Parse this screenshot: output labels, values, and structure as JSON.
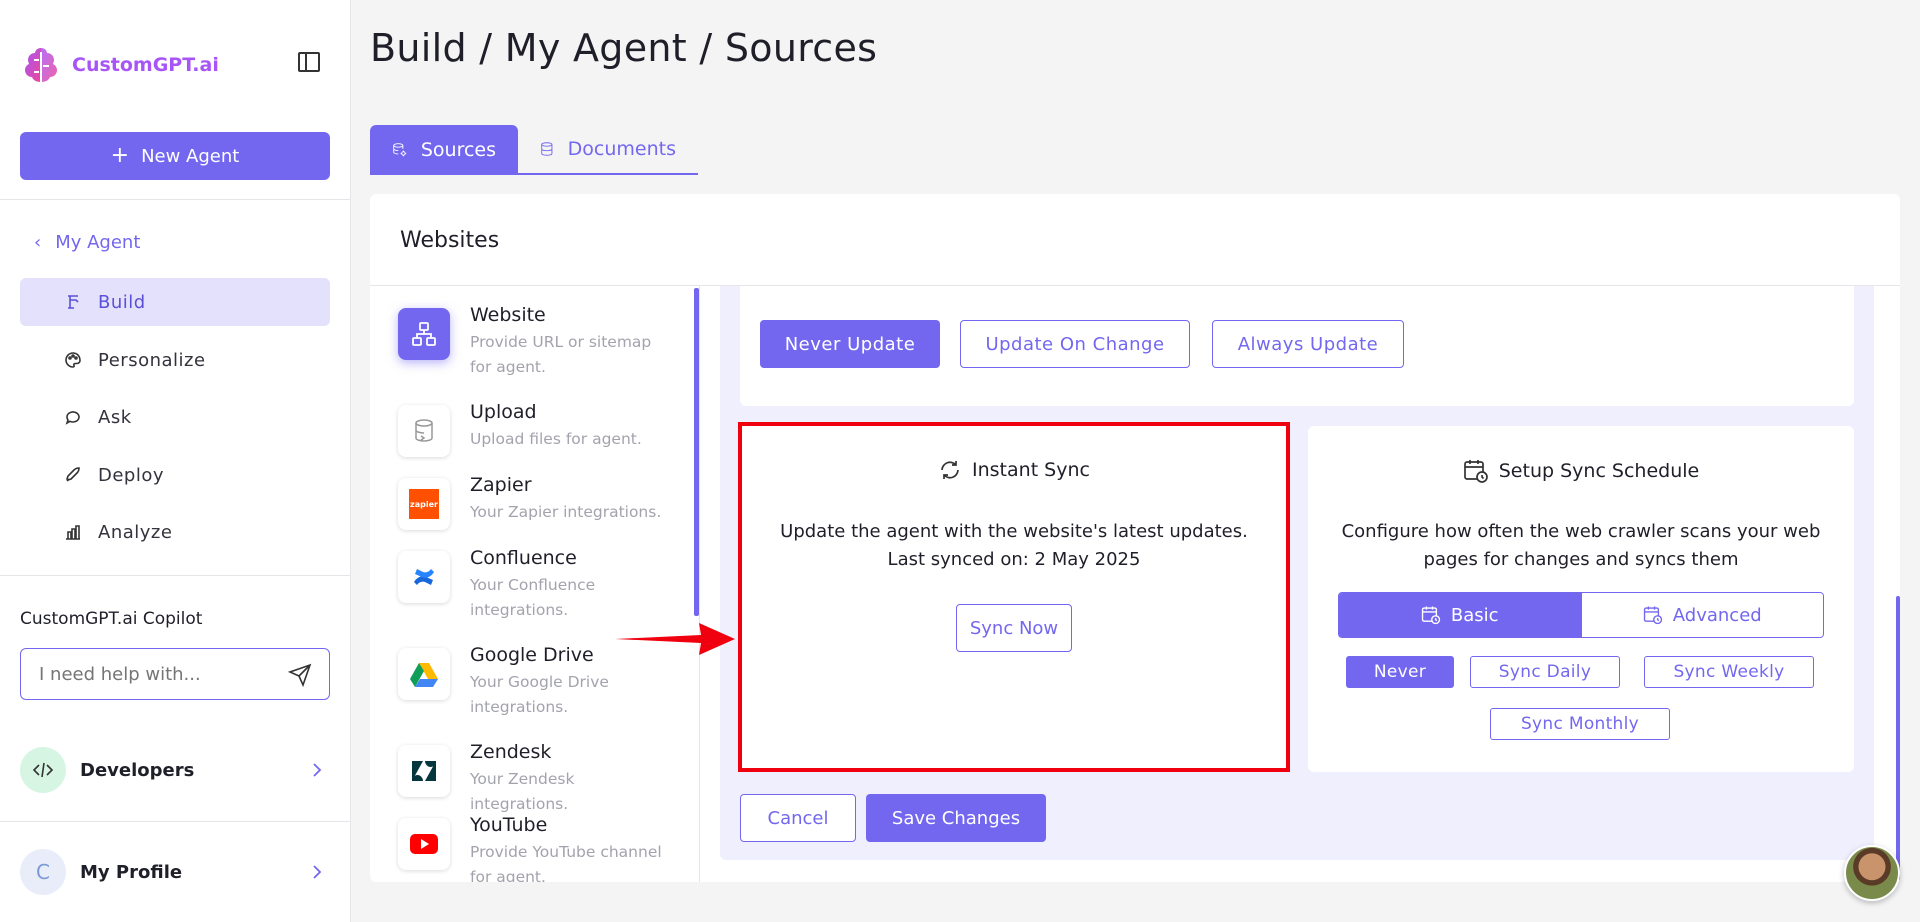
{
  "brand": {
    "name": "CustomGPT.ai"
  },
  "sidebar": {
    "new_agent_label": "New Agent",
    "back_label": "My Agent",
    "nav": [
      {
        "label": "Build",
        "icon": "build-icon",
        "active": true
      },
      {
        "label": "Personalize",
        "icon": "palette-icon",
        "active": false
      },
      {
        "label": "Ask",
        "icon": "chat-icon",
        "active": false
      },
      {
        "label": "Deploy",
        "icon": "rocket-icon",
        "active": false
      },
      {
        "label": "Analyze",
        "icon": "bar-chart-icon",
        "active": false
      }
    ],
    "copilot": {
      "title": "CustomGPT.ai Copilot",
      "placeholder": "I need help with..."
    },
    "developers_label": "Developers",
    "profile": {
      "initial": "C",
      "label": "My Profile"
    }
  },
  "header": {
    "breadcrumb": "Build / My Agent / Sources"
  },
  "tabs": [
    {
      "label": "Sources",
      "active": true
    },
    {
      "label": "Documents",
      "active": false
    }
  ],
  "panel": {
    "title": "Websites",
    "sources": [
      {
        "name": "Website",
        "desc": "Provide URL or sitemap for agent."
      },
      {
        "name": "Upload",
        "desc": "Upload files for agent."
      },
      {
        "name": "Zapier",
        "desc": "Your Zapier integrations."
      },
      {
        "name": "Confluence",
        "desc": "Your Confluence integrations."
      },
      {
        "name": "Google Drive",
        "desc": "Your Google Drive integrations."
      },
      {
        "name": "Zendesk",
        "desc": "Your Zendesk integrations."
      },
      {
        "name": "YouTube",
        "desc": "Provide YouTube channel for agent."
      }
    ],
    "zapier_logo_text": "zapier",
    "update_options": [
      "Never Update",
      "Update On Change",
      "Always Update"
    ],
    "instant_sync": {
      "title": "Instant Sync",
      "text": "Update the agent with the website's latest updates. Last synced on: 2 May 2025",
      "button": "Sync Now"
    },
    "schedule": {
      "title": "Setup Sync Schedule",
      "text": "Configure how often the web crawler scans your web pages for changes and syncs them",
      "modes": [
        "Basic",
        "Advanced"
      ],
      "frequencies": [
        "Never",
        "Sync Daily",
        "Sync Weekly",
        "Sync Monthly"
      ]
    },
    "cancel_label": "Cancel",
    "save_label": "Save Changes"
  },
  "colors": {
    "accent": "#7367f0",
    "highlight": "#f0000f",
    "brand": "#a855f7"
  }
}
